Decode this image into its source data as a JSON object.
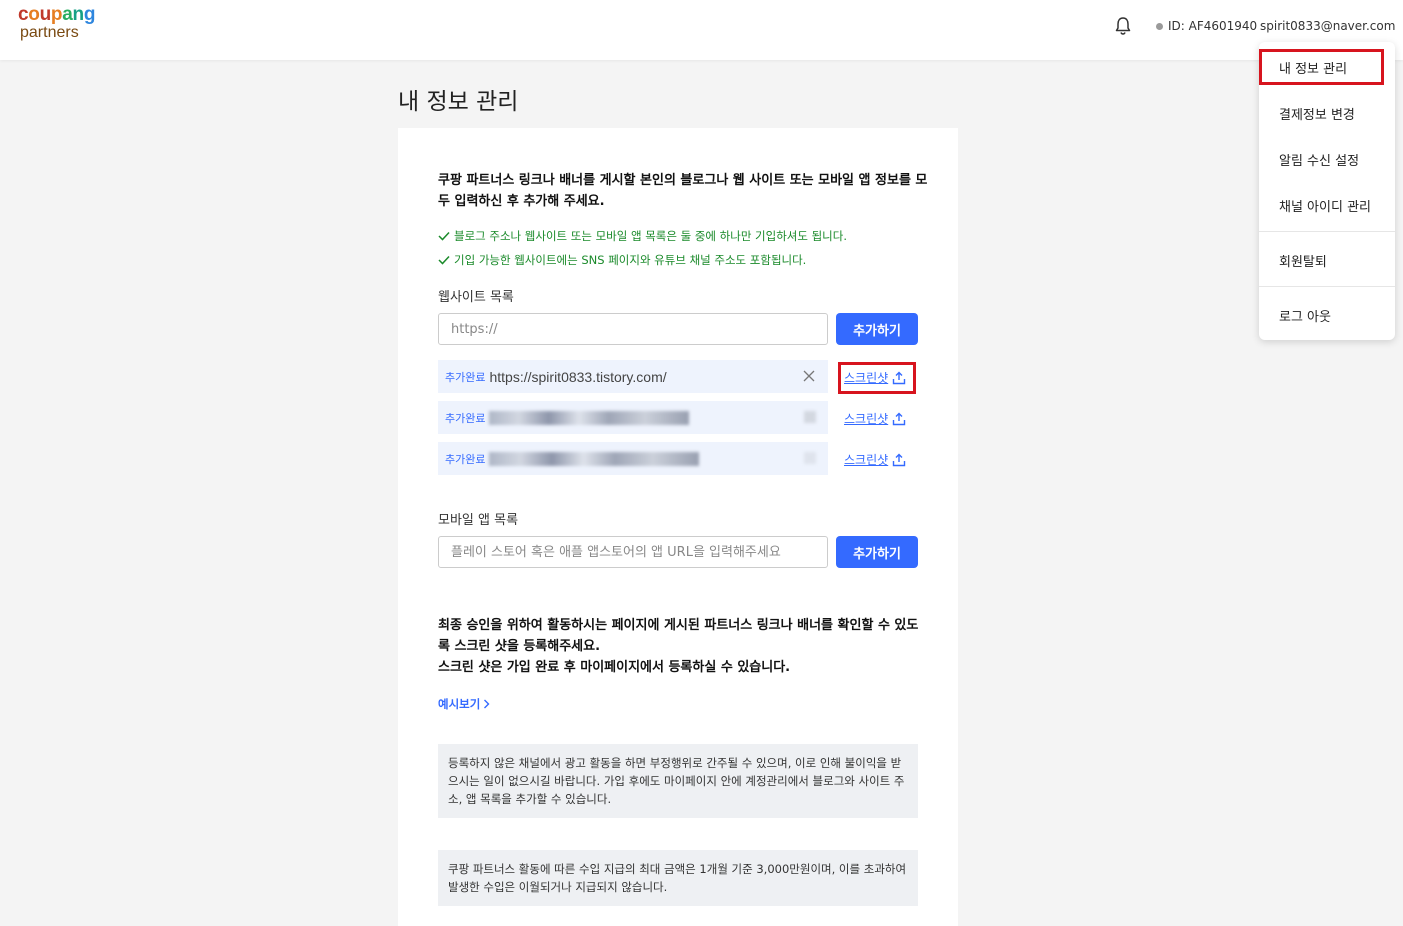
{
  "header": {
    "logo_top": "coupang",
    "logo_bottom": "partners",
    "user_id": "ID: AF4601940",
    "email": "spirit0833@naver.com"
  },
  "dropdown": {
    "items": [
      "내 정보 관리",
      "결제정보 변경",
      "알림 수신 설정",
      "채널 아이디 관리",
      "회원탈퇴",
      "로그 아웃"
    ]
  },
  "page": {
    "title": "내 정보 관리"
  },
  "card": {
    "lead": "쿠팡 파트너스 링크나 배너를 게시할 본인의 블로그나 웹 사이트 또는 모바일 앱 정보를 모두 입력하신 후 추가해 주세요.",
    "check1": "블로그 주소나 웹사이트 또는 모바일 앱 목록은 둘 중에 하나만 기입하셔도 됩니다.",
    "check2": "기입 가능한 웹사이트에는 SNS 페이지와 유튜브 채널 주소도 포함됩니다.",
    "website_label": "웹사이트 목록",
    "website_placeholder": "https://",
    "add_label": "추가하기",
    "sites": [
      {
        "badge": "추가완료",
        "url": "https://spirit0833.tistory.com/",
        "screenshot": "스크린샷"
      },
      {
        "badge": "추가완료",
        "url": "",
        "screenshot": "스크린샷"
      },
      {
        "badge": "추가완료",
        "url": "",
        "screenshot": "스크린샷"
      }
    ],
    "mobile_label": "모바일 앱 목록",
    "mobile_placeholder": "플레이 스토어 혹은 애플 앱스토어의 앱 URL을 입력해주세요",
    "para2_line1": "최종 승인을 위하여 활동하시는 페이지에 게시된 파트너스 링크나 배너를 확인할 수 있도록 스크린 샷을 등록해주세요.",
    "para2_line2": "스크린 샷은 가입 완료 후 마이페이지에서 등록하실 수 있습니다.",
    "example_label": "예시보기",
    "notice1": "등록하지 않은 채널에서 광고 활동을 하면 부정행위로 간주될 수 있으며, 이로 인해 불이익을 받으시는 일이 없으시길 바랍니다. 가입 후에도 마이페이지 안에 계정관리에서 블로그와 사이트 주소, 앱 목록을 추가할 수 있습니다.",
    "notice2": "쿠팡 파트너스 활동에 따른 수입 지급의 최대 금액은 1개월 기준 3,000만원이며, 이를 초과하여 발생한 수입은 이월되거나 지급되지 않습니다."
  },
  "colors": {
    "accent": "#346aff",
    "check_green": "#1a8a2a",
    "highlight_red": "#d7141e"
  }
}
